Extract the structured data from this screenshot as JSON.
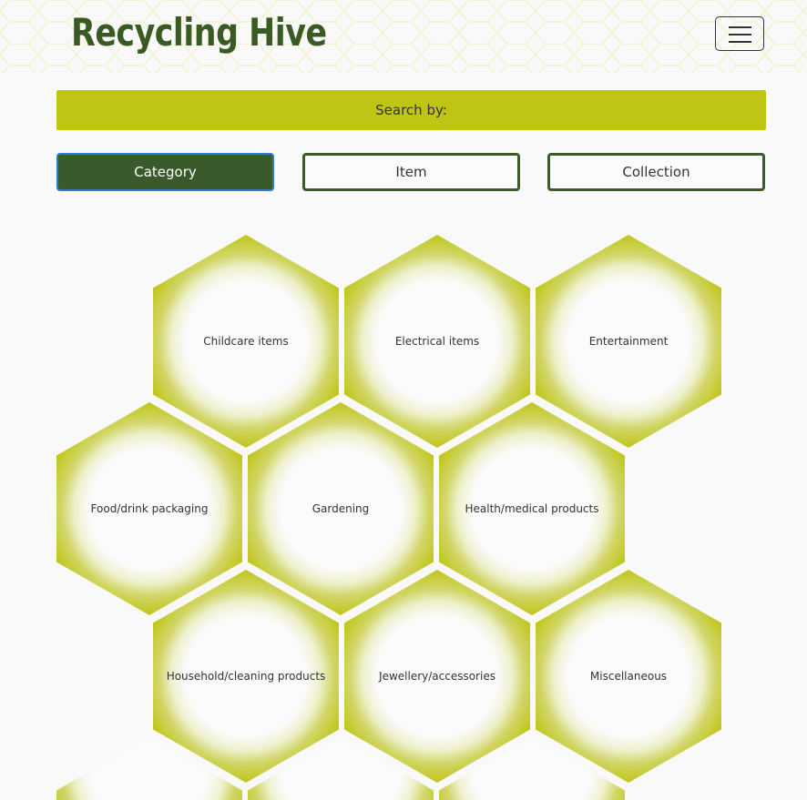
{
  "header": {
    "brand": "Recycling Hive",
    "menu_icon": "hamburger-menu-icon"
  },
  "search": {
    "label": "Search by:"
  },
  "tabs": [
    {
      "label": "Category",
      "active": true
    },
    {
      "label": "Item",
      "active": false
    },
    {
      "label": "Collection",
      "active": false
    }
  ],
  "categories": [
    "Childcare items",
    "Electrical items",
    "Entertainment",
    "Food/drink packaging",
    "Gardening",
    "Health/medical products",
    "Household/cleaning products",
    "Jewellery/accessories",
    "Miscellaneous",
    "",
    "",
    ""
  ],
  "colors": {
    "brand_green": "#3a5a24",
    "banner_yellow": "#bec515",
    "active_tab": "#3a5a2b",
    "focus_ring": "#2c7bd8"
  }
}
